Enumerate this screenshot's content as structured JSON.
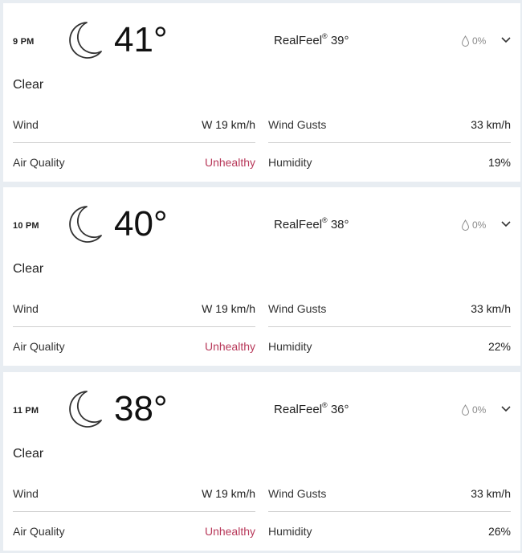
{
  "hours": [
    {
      "time": "9 PM",
      "temp": "41°",
      "realfeel_label": "RealFeel",
      "realfeel_deg": "®",
      "realfeel_value": "39°",
      "precip": "0%",
      "phrase": "Clear",
      "wind_label": "Wind",
      "wind_value": "W 19 km/h",
      "gusts_label": "Wind Gusts",
      "gusts_value": "33 km/h",
      "aq_label": "Air Quality",
      "aq_value": "Unhealthy",
      "humidity_label": "Humidity",
      "humidity_value": "19%",
      "icon": "moon-icon"
    },
    {
      "time": "10 PM",
      "temp": "40°",
      "realfeel_label": "RealFeel",
      "realfeel_deg": "®",
      "realfeel_value": "38°",
      "precip": "0%",
      "phrase": "Clear",
      "wind_label": "Wind",
      "wind_value": "W 19 km/h",
      "gusts_label": "Wind Gusts",
      "gusts_value": "33 km/h",
      "aq_label": "Air Quality",
      "aq_value": "Unhealthy",
      "humidity_label": "Humidity",
      "humidity_value": "22%",
      "icon": "moon-icon"
    },
    {
      "time": "11 PM",
      "temp": "38°",
      "realfeel_label": "RealFeel",
      "realfeel_deg": "®",
      "realfeel_value": "36°",
      "precip": "0%",
      "phrase": "Clear",
      "wind_label": "Wind",
      "wind_value": "W 19 km/h",
      "gusts_label": "Wind Gusts",
      "gusts_value": "33 km/h",
      "aq_label": "Air Quality",
      "aq_value": "Unhealthy",
      "humidity_label": "Humidity",
      "humidity_value": "26%",
      "icon": "moon-icon"
    }
  ],
  "colors": {
    "background": "#e8edf2",
    "card": "#ffffff",
    "unhealthy": "#b8395a",
    "muted": "#8a8a8a"
  }
}
